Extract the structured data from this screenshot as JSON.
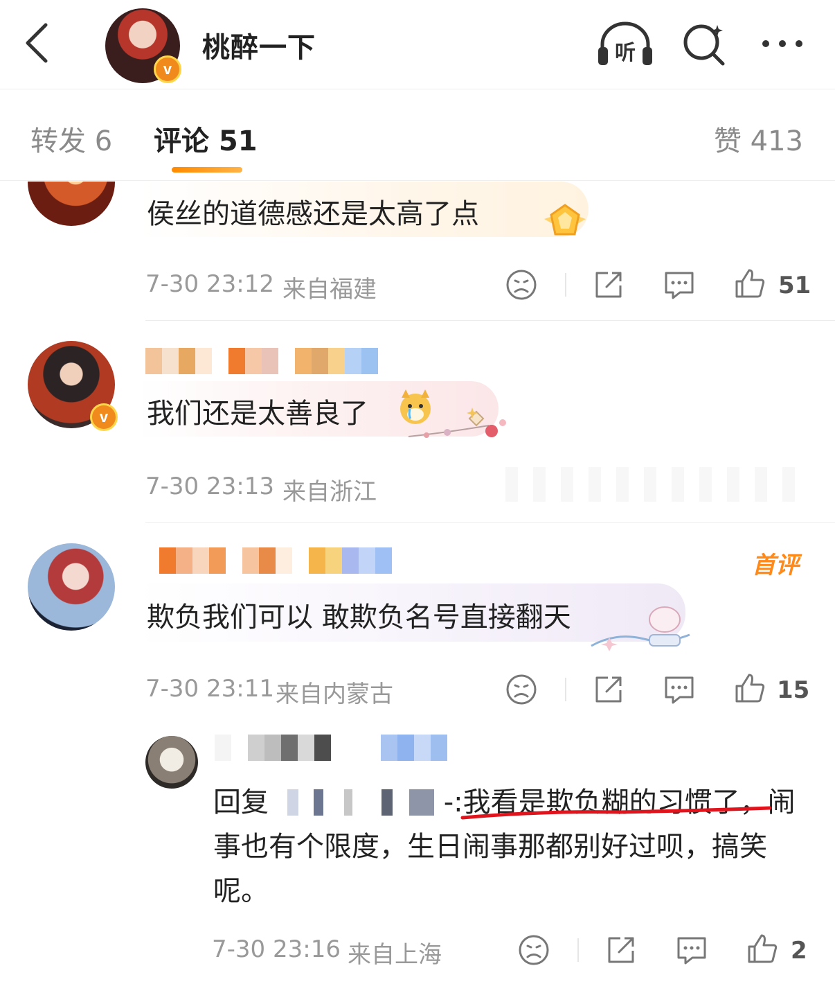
{
  "header": {
    "title": "桃醉一下",
    "listen_label": "听"
  },
  "tabs": {
    "repost": "转发 6",
    "comment": "评论 51",
    "likes": "赞 413"
  },
  "comments": [
    {
      "text": "侯丝的道德感还是太高了点",
      "time": "7-30 23:12",
      "location": "来自福建",
      "likes": "51"
    },
    {
      "text": "我们还是太善良了",
      "time": "7-30 23:13",
      "location": "来自浙江",
      "likes": ""
    },
    {
      "text": "欺负我们可以 敢欺负名号直接翻天",
      "time": "7-30 23:11",
      "location": "来自内蒙古",
      "likes": "15",
      "badge": "首评"
    }
  ],
  "reply": {
    "prefix": "回复",
    "colon": "-:",
    "highlighted": "我看是欺负糊的习惯",
    "rest": "了，闹事也有个限度，生日闹事那都别好过呗，搞笑呢。",
    "time": "7-30 23:16",
    "location": "来自上海",
    "likes": "2"
  },
  "colors": {
    "accent": "#ff8a00",
    "underline_red": "#e0141c",
    "verified": "#f08a1c"
  }
}
